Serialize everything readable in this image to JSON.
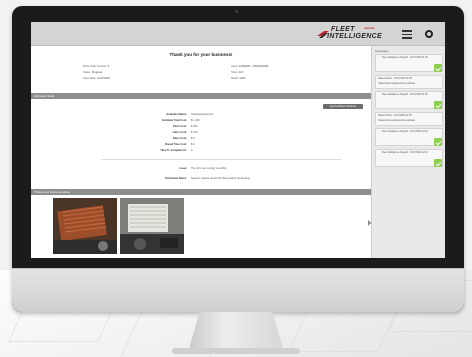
{
  "brand": {
    "line1": "FLEET",
    "line2": "INTELLIGENCE",
    "tag": "vamvid",
    "accent": "#c0282d"
  },
  "header": {
    "menu_icon": "hamburger-menu-icon",
    "user_icon": "user-icon"
  },
  "main": {
    "title": "Thank you for your business!",
    "fields_left": [
      {
        "label": "Work Order Number:",
        "value": "0"
      },
      {
        "label": "Status:",
        "value": "Progress"
      },
      {
        "label": "Open Date:",
        "value": "11/17/2023"
      }
    ],
    "fields_right": [
      {
        "label": "Asset:",
        "value": "12093451 - 1000001A/84"
      },
      {
        "label": "Shop:",
        "value": "ALS"
      },
      {
        "label": "Model:",
        "value": "GMC"
      }
    ],
    "estimate_section": "Estimate Detail",
    "approve_button": "Approve/Reject Estimate",
    "estimate_rows": [
      {
        "label": "Estimate Status:",
        "value": "Awaiting Response"
      },
      {
        "label": "Estimate Total Cost:",
        "value": "$ 1,100"
      },
      {
        "label": "Parts Cost:",
        "value": "$ 400"
      },
      {
        "label": "Labor Cost:",
        "value": "$ 700"
      },
      {
        "label": "Other Cost:",
        "value": "$ 0"
      },
      {
        "label": "Diesel Time Cost:",
        "value": "$ 0"
      },
      {
        "label": "Time To Complete Hr:",
        "value": "4"
      }
    ],
    "issue": {
      "label": "Issue:",
      "value": "The oil is not running smoothly."
    },
    "technician_notes": {
      "label": "Technician Notes:",
      "value": "Need to replace oil and air filters before proceeding."
    },
    "photos_section": "Photos and Documentation",
    "photos": [
      "dirty-air-filter-photo",
      "engine-air-filter-housing-photo"
    ]
  },
  "panel": {
    "title": "Messages",
    "messages": [
      {
        "sender": "Fleet Intelligence Support",
        "time": "11/17/2023 11:46",
        "text": ""
      },
      {
        "sender": "Tasked Driver",
        "time": "11/17/2023 11:48",
        "text": "Tasked driver approved the estimate."
      },
      {
        "sender": "Fleet Intelligence Support",
        "time": "11/17/2023 11:52",
        "text": ""
      },
      {
        "sender": "Tasked Driver",
        "time": "11/17/2023 11:55",
        "text": "Tasked driver approved the estimate."
      },
      {
        "sender": "Fleet Intelligence Support",
        "time": "11/17/2023 12:01",
        "text": ""
      },
      {
        "sender": "Fleet Intelligence Support",
        "time": "11/17/2023 12:10",
        "text": ""
      }
    ]
  }
}
